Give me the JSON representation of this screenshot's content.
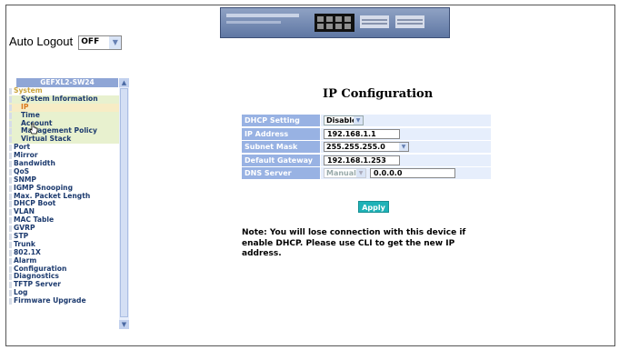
{
  "auto_logout": {
    "label": "Auto Logout",
    "value": "OFF"
  },
  "nav": {
    "header": "GEFXL2-SW24",
    "items": [
      {
        "label": "System",
        "kind": "sys"
      },
      {
        "label": "System Information",
        "kind": "sub"
      },
      {
        "label": "IP",
        "kind": "sub cur"
      },
      {
        "label": "Time",
        "kind": "sub"
      },
      {
        "label": "Account",
        "kind": "sub"
      },
      {
        "label": "Management Policy",
        "kind": "sub"
      },
      {
        "label": "Virtual Stack",
        "kind": "sub"
      },
      {
        "label": "Port",
        "kind": ""
      },
      {
        "label": "Mirror",
        "kind": ""
      },
      {
        "label": "Bandwidth",
        "kind": ""
      },
      {
        "label": "QoS",
        "kind": ""
      },
      {
        "label": "SNMP",
        "kind": ""
      },
      {
        "label": "IGMP Snooping",
        "kind": ""
      },
      {
        "label": "Max. Packet Length",
        "kind": ""
      },
      {
        "label": "DHCP Boot",
        "kind": ""
      },
      {
        "label": "VLAN",
        "kind": ""
      },
      {
        "label": "MAC Table",
        "kind": ""
      },
      {
        "label": "GVRP",
        "kind": ""
      },
      {
        "label": "STP",
        "kind": ""
      },
      {
        "label": "Trunk",
        "kind": ""
      },
      {
        "label": "802.1X",
        "kind": ""
      },
      {
        "label": "Alarm",
        "kind": ""
      },
      {
        "label": "Configuration",
        "kind": ""
      },
      {
        "label": "Diagnostics",
        "kind": ""
      },
      {
        "label": "TFTP Server",
        "kind": ""
      },
      {
        "label": "Log",
        "kind": ""
      },
      {
        "label": "Firmware Upgrade",
        "kind": ""
      }
    ]
  },
  "page_title": "IP Configuration",
  "config": {
    "dhcp_setting": {
      "label": "DHCP Setting",
      "value": "Disable"
    },
    "ip_address": {
      "label": "IP Address",
      "value": "192.168.1.1"
    },
    "subnet_mask": {
      "label": "Subnet Mask",
      "value": "255.255.255.0"
    },
    "default_gateway": {
      "label": "Default Gateway",
      "value": "192.168.1.253"
    },
    "dns_server": {
      "label": "DNS Server",
      "mode": "Manual",
      "value": "0.0.0.0"
    }
  },
  "apply_label": "Apply",
  "note": "Note: You will lose connection with this device if enable DHCP. Please use CLI to get the new IP address.",
  "colors": {
    "label_bg": "#98b2e3",
    "value_bg": "#e6eefc",
    "apply_bg": "#1fb2b7",
    "nav_header_bg": "#8fa6d6",
    "system_text": "#caa43c",
    "current_item_text": "#d97a1f"
  }
}
